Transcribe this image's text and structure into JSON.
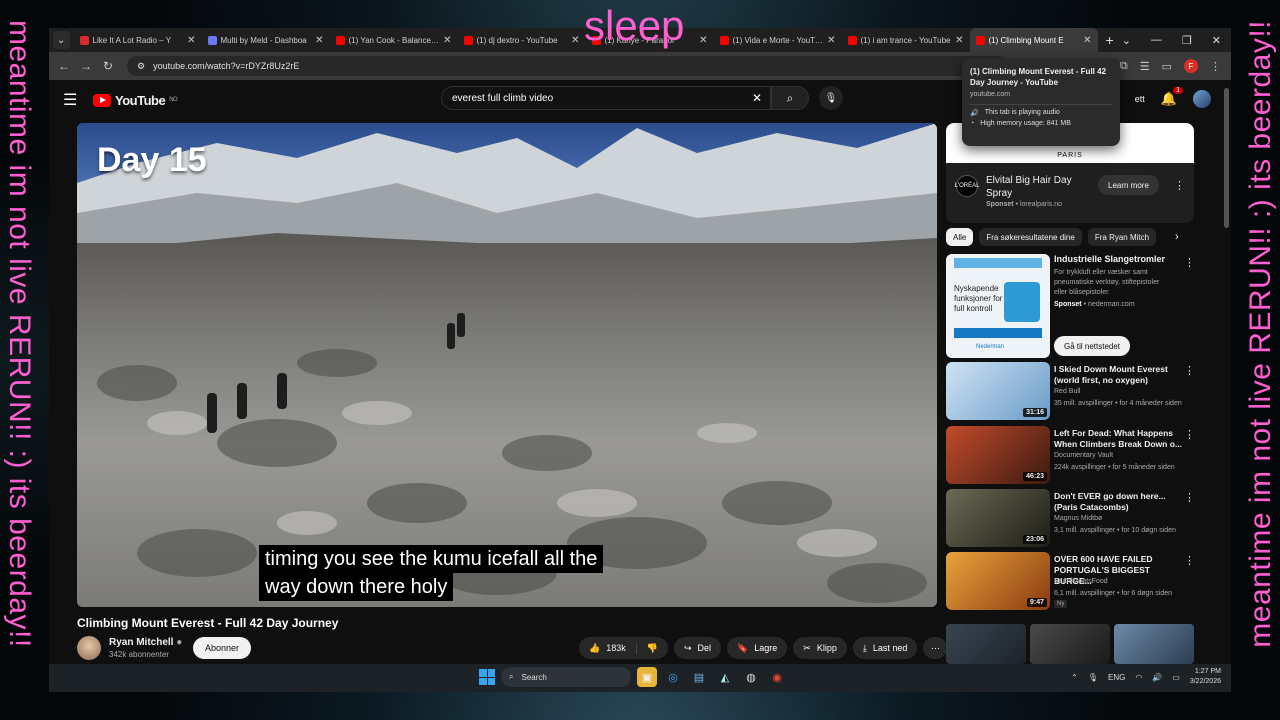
{
  "overlay": {
    "left_text": "meantime im not live RERUN!! :) its beerday!!",
    "right_text": "meantime im not live RERUN!! :) its beerday!!",
    "top_text": "sleep"
  },
  "browser": {
    "tabs": [
      {
        "title": "Like It A Lot Radio – Y",
        "color": "#d82c2c"
      },
      {
        "title": "Multi by Meld - Dashboa",
        "color": "#6b7bf5"
      },
      {
        "title": "(1) Yan Cook - Balance - Y",
        "color": "#ff0000"
      },
      {
        "title": "(1) dj dextro - YouTube",
        "color": "#ff0000"
      },
      {
        "title": "(1) Kanye - Paranoi",
        "color": "#ff0000"
      },
      {
        "title": "(1) Vida e Morte - YouTub",
        "color": "#ff0000"
      },
      {
        "title": "(1) i am trance - YouTube",
        "color": "#ff0000"
      },
      {
        "title": "(1) Climbing Mount E",
        "color": "#ff0000",
        "active": true
      }
    ],
    "url": "youtube.com/watch?v=rDYZr8Uz2rE",
    "profile_letter": "F"
  },
  "tooltip": {
    "title": "(1) Climbing Mount Everest - Full 42 Day Journey - YouTube",
    "domain": "youtube.com",
    "audio": "This tab is playing audio",
    "memory": "High memory usage: 841 MB"
  },
  "youtube": {
    "logo": "YouTube",
    "region": "NO",
    "search_query": "everest full climb video",
    "notif_count": "1",
    "create_label": "ett"
  },
  "video": {
    "overlay_day": "Day 15",
    "caption_line1": "timing you see the kumu icefall all the",
    "caption_line2": "way down there holy",
    "title": "Climbing Mount Everest - Full 42 Day Journey",
    "channel": "Ryan Mitchell",
    "subscribers": "342k abonnenter",
    "subscribe_label": "Abonner",
    "likes": "183k",
    "share": "Del",
    "save": "Lagre",
    "clip": "Klipp",
    "download": "Last ned"
  },
  "ad_top": {
    "banner": "PARIS",
    "logo": "L'ORÉAL",
    "title": "Elvital Big Hair Day Spray",
    "sponsored": "Sponset",
    "domain": "lorealparis.no",
    "cta": "Learn more"
  },
  "chips": [
    "Alle",
    "Fra søkeresultatene dine",
    "Fra Ryan Mitch"
  ],
  "ad2": {
    "title": "Industrielle Slangetromler",
    "desc": "For trykkluft eller væsker samt pneumatiske verktøy, stiftepistoler eller blåsepistoler.",
    "sponsored": "Sponset",
    "domain": "nederman.com",
    "cta": "Gå til nettstedet",
    "img_text": "Nyskapende funksjoner for full kontroll",
    "brand": "Nederman"
  },
  "recommendations": [
    {
      "title": "I Skied Down Mount Everest (world first, no oxygen)",
      "channel": "Red Bull",
      "views": "35 mill. avspillinger • for 4 måneder siden",
      "duration": "31:16",
      "c1": "#cfe3f3",
      "c2": "#6a9cc9"
    },
    {
      "title": "Left For Dead: What Happens When Climbers Break Down o...",
      "channel": "Documentary Vault",
      "views": "224k avspillinger • for 5 måneder siden",
      "duration": "46:23",
      "c1": "#c34b2a",
      "c2": "#3b1a12"
    },
    {
      "title": "Don't EVER go down here... (Paris Catacombs)",
      "channel": "Magnus Midtbø",
      "views": "3,1 mill. avspillinger • for 10 døgn siden",
      "duration": "23:06",
      "c1": "#6b6a55",
      "c2": "#1e1d16"
    },
    {
      "title": "OVER 600 HAVE FAILED PORTUGAL'S BIGGEST BURGE...",
      "channel": "BeardMeatsFood",
      "views": "6,1 mill. avspillinger • for 6 døgn siden",
      "duration": "9:47",
      "badge": "Ny",
      "c1": "#e8a33a",
      "c2": "#8a3b12"
    }
  ],
  "taskbar": {
    "search": "Search",
    "lang": "ENG",
    "time": "1:27 PM",
    "date": "3/22/2026"
  }
}
